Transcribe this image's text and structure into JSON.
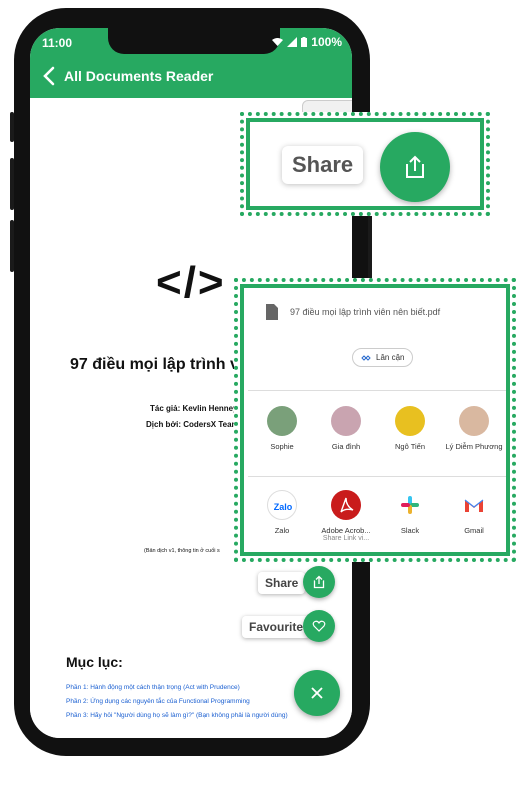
{
  "status": {
    "time": "11:00",
    "battery": "100%"
  },
  "appbar": {
    "title": "All Documents Reader"
  },
  "document": {
    "code_symbol": "</>",
    "title": "97 điều mọi lập trình v",
    "author": "Tác giả: Kevlin Henney",
    "translator": "Dịch bởi: CodersX Team",
    "note": "(Bản dịch v1, thông tin ở cuối s",
    "toc_heading": "Mục lục:",
    "toc": [
      "Phần 1: Hành động một cách thận trọng (Act with Prudence)",
      "Phần 2: Ứng dụng các nguyên tắc của Functional Programming",
      "Phần 3: Hãy hỏi \"Người dùng họ sẽ làm gì?\" (Bạn không phải là người dùng)"
    ]
  },
  "fab_menu": {
    "share_label": "Share",
    "favourite_label": "Favourite"
  },
  "callout_share": {
    "label": "Share"
  },
  "share_sheet": {
    "file_name": "97 điều mọi lập trình viên nên biết.pdf",
    "nearby_label": "Lân cận",
    "contacts": [
      {
        "name": "Sophie",
        "color": "#7aa07a"
      },
      {
        "name": "Gia đình",
        "color": "#c9a4b0"
      },
      {
        "name": "Ngô Tiến",
        "color": "#e8c020"
      },
      {
        "name": "Lý Diễm Phương",
        "color": "#d9b8a0"
      }
    ],
    "apps": [
      {
        "name": "Zalo",
        "sub": ""
      },
      {
        "name": "Adobe Acrob...",
        "sub": "Share Link vi..."
      },
      {
        "name": "Slack",
        "sub": ""
      },
      {
        "name": "Gmail",
        "sub": ""
      }
    ]
  },
  "colors": {
    "accent": "#27a961"
  }
}
